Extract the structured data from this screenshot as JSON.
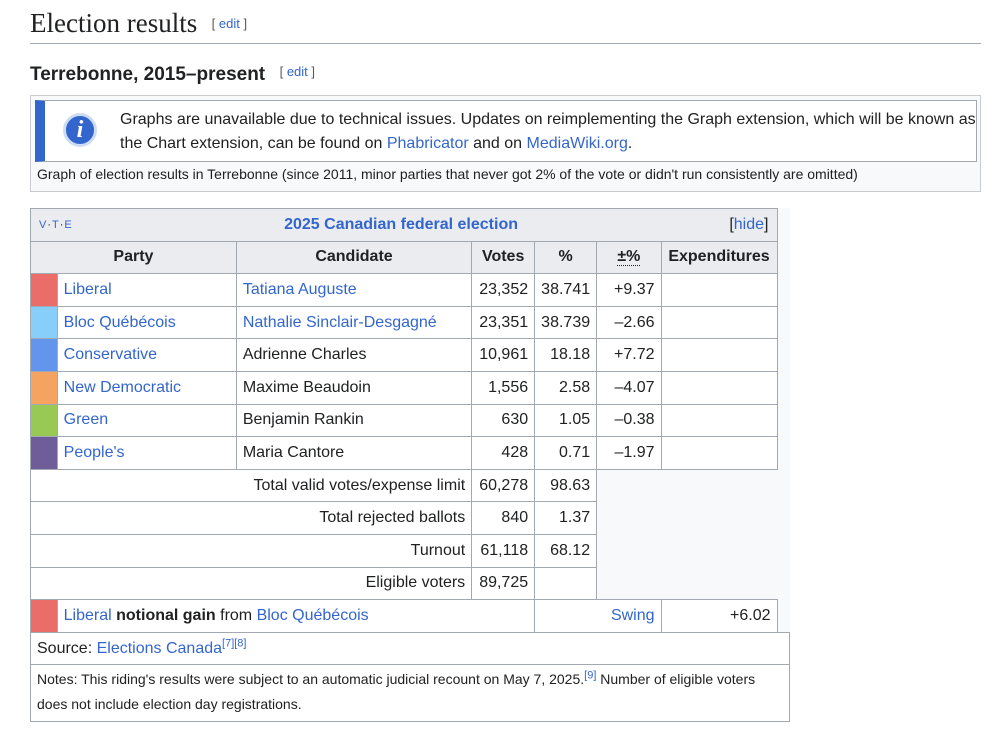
{
  "section": {
    "title": "Election results",
    "edit": "edit"
  },
  "subsection": {
    "title": "Terrebonne, 2015–present",
    "edit": "edit"
  },
  "graph_notice": {
    "text_before": "Graphs are unavailable due to technical issues. Updates on reimplementing the Graph extension, which will be known as the Chart extension, can be found on ",
    "link1": "Phabricator",
    "text_mid": " and on ",
    "link2": "MediaWiki.org",
    "text_after": ".",
    "caption": "Graph of election results in Terrebonne (since 2011, minor parties that never got 2% of the vote or didn't run consistently are omitted)"
  },
  "table": {
    "vte": {
      "v": "V",
      "t": "T",
      "e": "E"
    },
    "title": "2025 Canadian federal election",
    "hide": "hide",
    "headers": [
      "Party",
      "Candidate",
      "Votes",
      "%",
      "±%",
      "Expenditures"
    ],
    "rows": [
      {
        "color": "#ea6d6a",
        "party": "Liberal",
        "candidate": "Tatiana Auguste",
        "candidate_link": true,
        "votes": "23,352",
        "pct": "38.741",
        "change": "+9.37",
        "exp": ""
      },
      {
        "color": "#87cefa",
        "party": "Bloc Québécois",
        "candidate": "Nathalie Sinclair-Desgagné",
        "candidate_link": true,
        "votes": "23,351",
        "pct": "38.739",
        "change": "–2.66",
        "exp": ""
      },
      {
        "color": "#6495ed",
        "party": "Conservative",
        "candidate": "Adrienne Charles",
        "candidate_link": false,
        "votes": "10,961",
        "pct": "18.18",
        "change": "+7.72",
        "exp": ""
      },
      {
        "color": "#f4a460",
        "party": "New Democratic",
        "candidate": "Maxime Beaudoin",
        "candidate_link": false,
        "votes": "1,556",
        "pct": "2.58",
        "change": "–4.07",
        "exp": ""
      },
      {
        "color": "#99c955",
        "party": "Green",
        "candidate": "Benjamin Rankin",
        "candidate_link": false,
        "votes": "630",
        "pct": "1.05",
        "change": "–0.38",
        "exp": ""
      },
      {
        "color": "#6f5d9a",
        "party": "People's",
        "candidate": "Maria Cantore",
        "candidate_link": false,
        "votes": "428",
        "pct": "0.71",
        "change": "–1.97",
        "exp": ""
      }
    ],
    "totals": [
      {
        "label": "Total valid votes/expense limit",
        "votes": "60,278",
        "pct": "98.63"
      },
      {
        "label": "Total rejected ballots",
        "votes": "840",
        "pct": "1.37"
      },
      {
        "label": "Turnout",
        "votes": "61,118",
        "pct": "68.12"
      },
      {
        "label": "Eligible voters",
        "votes": "89,725",
        "pct": ""
      }
    ],
    "gain": {
      "color": "#ea6d6a",
      "party": "Liberal",
      "bold": "notional gain",
      "from": "from",
      "from_party": "Bloc Québécois",
      "swing_label": "Swing",
      "swing": "+6.02"
    },
    "source": {
      "label": "Source:",
      "link": "Elections Canada",
      "refs": "[7][8]"
    },
    "notes": {
      "text1": "Notes: This riding's results were subject to an automatic judicial recount on May 7, 2025.",
      "ref": "[9]",
      "text2": " Number of eligible voters does not include election day registrations."
    }
  }
}
